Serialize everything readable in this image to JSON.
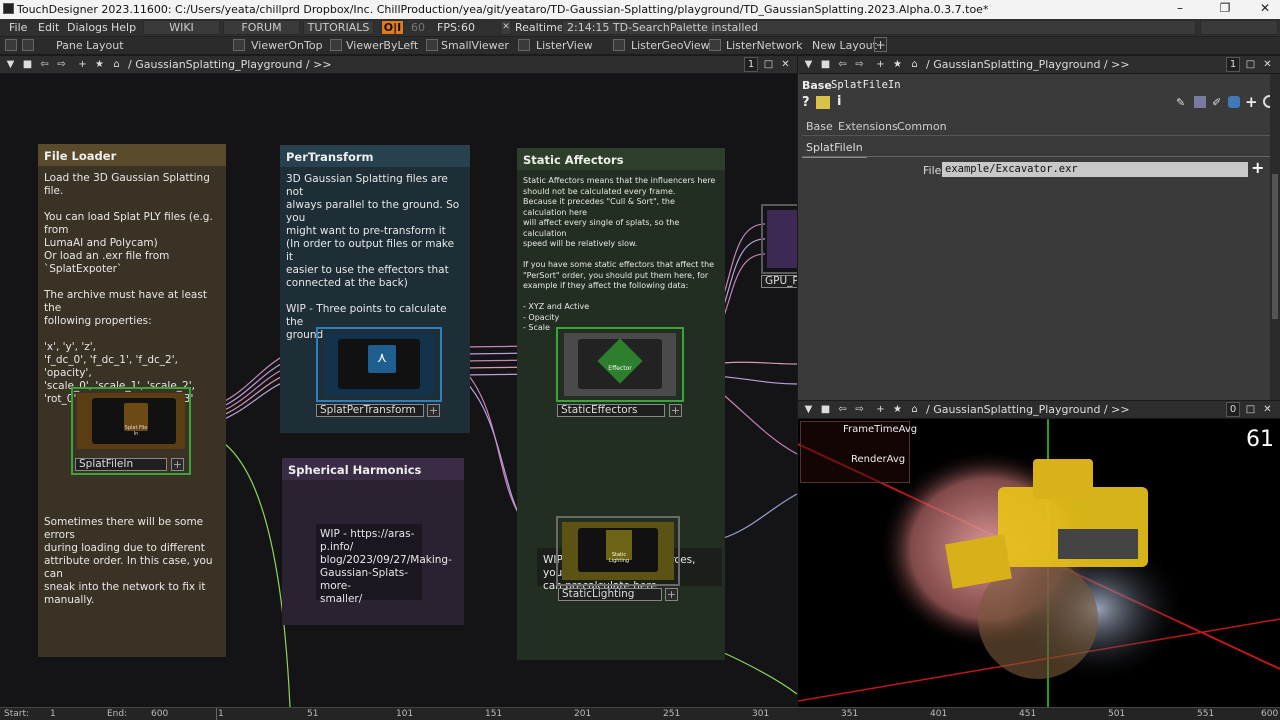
{
  "window": {
    "title": "TouchDesigner 2023.11600: C:/Users/yeata/chillprd Dropbox/Inc. ChillProduction/yea/git/yeataro/TD-Gaussian-Splatting/playground/TD_GaussianSplatting.2023.Alpha.0.3.7.toe*",
    "minimize": "–",
    "maximize": "❐",
    "close": "✕"
  },
  "menubar": {
    "items": [
      "File",
      "Edit",
      "Dialogs",
      "Help"
    ],
    "buttons": [
      "WIKI",
      "FORUM",
      "TUTORIALS"
    ],
    "oi": "O|I",
    "fps_target": "60",
    "fps_label": "FPS:",
    "fps_value": "60",
    "realtime_check": "✕",
    "realtime_label": "Realtime",
    "status": "2:14:15 TD-SearchPalette installed"
  },
  "panebar": {
    "items": [
      "Pane Layout",
      "ViewerOnTop",
      "ViewerByLeft",
      "SmallViewer",
      "ListerView",
      "ListerGeoView",
      "ListerNetwork",
      "New Layout"
    ],
    "add": "+"
  },
  "network_path": {
    "path": "/ GaussianSplatting_Playground / >>",
    "count": "1"
  },
  "params_path": {
    "path": "/ GaussianSplatting_Playground / >>",
    "count": "1"
  },
  "viewer_path": {
    "path": "/ GaussianSplatting_Playground / >>",
    "count": "0"
  },
  "annotations": {
    "file_loader": {
      "title": "File Loader",
      "body": "Load the 3D Gaussian Splatting file.\n\nYou can load Splat PLY files (e.g. from\nLumaAI and Polycam)\nOr load an .exr file from `SplatExpoter`\n\nThe archive must have at least the\nfollowing properties:\n\n'x', 'y', 'z',\n'f_dc_0', 'f_dc_1', 'f_dc_2', 'opacity',\n'scale_0', 'scale_1', 'scale_2',\n'rot_0', 'rot_1', 'rot_2', 'rot_3'",
      "footer": "Sometimes there will be some errors\nduring loading due to different\nattribute order. In this case, you can\nsneak into the network to fix it\nmanually."
    },
    "per_transform": {
      "title": "PerTransform",
      "body": "3D Gaussian Splatting files are not\nalways parallel to the ground. So you\nmight want to pre-transform it\n(In order to output files or make it\neasier to use the effectors that\nconnected at the back)\n\nWIP - Three points to calculate the\nground"
    },
    "static_affectors": {
      "title": "Static Affectors",
      "body": "Static Affectors means that the influencers here\nshould not be calculated every frame.\nBecause it precedes \"Cull & Sort\", the calculation here\nwill affect every single of splats, so the calculation\nspeed will be relatively slow.\n\nIf you have some static effectors that affect the\n\"PerSort\" order, you should put them here, for\nexample if they affect the following data:\n\n- XYZ and Active\n- Opacity\n- Scale",
      "wip": "WIP - For static light sources, you\ncan precalculate here"
    },
    "spherical_harmonics": {
      "title": "Spherical Harmonics",
      "body": "WIP - https://aras-p.info/\nblog/2023/09/27/Making-\nGaussian-Splats-more-\nsmaller/"
    }
  },
  "nodes": {
    "splat_file_in": {
      "label": "SplatFileIn",
      "inner": "Splat File In"
    },
    "splat_per_transform": {
      "label": "SplatPerTransform",
      "inner": "Splat Per Transform"
    },
    "static_effectors": {
      "label": "StaticEffectors",
      "inner": "Effector"
    },
    "static_lighting": {
      "label": "StaticLighting",
      "inner": "Static Lighting"
    },
    "gpu_perf": {
      "label": "GPU_Pe"
    }
  },
  "params": {
    "type": "Base",
    "name": "SplatFileIn",
    "tabs": [
      "Base",
      "Extensions",
      "Common"
    ],
    "active_page": "SplatFileIn",
    "file_label": "File",
    "file_value": "example/Excavator.exr"
  },
  "viewer": {
    "fps": "61",
    "perf_labels": [
      "FrameTimeAvg",
      "RenderAvg"
    ]
  },
  "timeline": {
    "start_label": "Start:",
    "start_value": "1",
    "end_label": "End:",
    "end_value": "600",
    "ticks": [
      "1",
      "51",
      "101",
      "151",
      "201",
      "251",
      "301",
      "351",
      "401",
      "451",
      "501",
      "551",
      "600"
    ]
  },
  "colors": {
    "file_loader": "#5a4a2c",
    "per_transform": "#27414f",
    "static_affectors": "#2d3f2b",
    "spherical_harmonics": "#3a2c45",
    "node_green": "#3aa63a",
    "node_blue": "#2d80c0",
    "wire_pink": "#c784b8",
    "wire_green": "#8fd45a"
  }
}
